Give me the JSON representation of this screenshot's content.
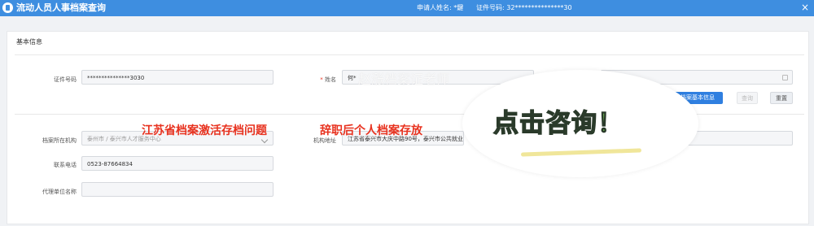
{
  "window": {
    "title": "流动人员人事档案查询",
    "applicant": "申请人姓名: *鍵",
    "id_info": "证件号码: 32***************30",
    "close": "×"
  },
  "section": {
    "title": "基本信息"
  },
  "fields": {
    "id_label": "证件号码",
    "id_value": "***************3030",
    "name_label": "姓名",
    "name_required": "*",
    "name_value": "何*",
    "date_value": "*",
    "org_label": "档案所在机构",
    "org_value": "泰州市 / 泰兴市人才服务中心",
    "addr_label": "机构地址",
    "addr_value": "江苏省泰兴市大庆中路90号，泰兴市公共就业",
    "phone_label": "联系电话",
    "phone_value": "0523-87664834",
    "agent_label": "代理单位名称",
    "agent_value": ""
  },
  "buttons": {
    "archive_info": "档案基本信息",
    "query": "查询",
    "reset": "重置"
  },
  "overlay": {
    "watermark": "赵涨档案证老师",
    "red1": "江苏省档案激活存档问题",
    "red2": "辞职后个人档案存放",
    "cta": "点击咨询！"
  },
  "colors": {
    "titlebar": "#3e8ee0",
    "red": "#e8321f",
    "cta_green": "#7cc95a"
  }
}
